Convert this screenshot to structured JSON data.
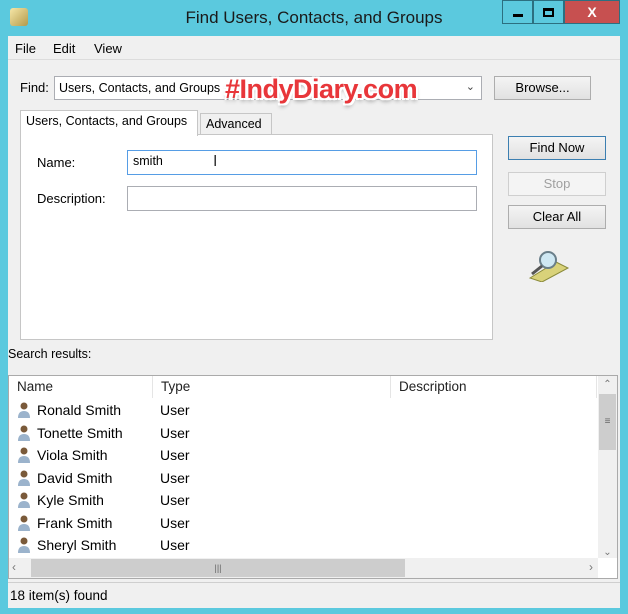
{
  "window": {
    "title": "Find Users, Contacts, and Groups",
    "close": "X"
  },
  "menu": [
    "File",
    "Edit",
    "View"
  ],
  "find": {
    "label": "Find:",
    "value": "Users, Contacts, and Groups",
    "browse": "Browse..."
  },
  "tabs": [
    "Users, Contacts, and Groups",
    "Advanced"
  ],
  "form": {
    "name_label": "Name:",
    "name_value": "smith",
    "description_label": "Description:",
    "description_value": ""
  },
  "actions": {
    "find_now": "Find Now",
    "stop": "Stop",
    "clear_all": "Clear All"
  },
  "results": {
    "label": "Search results:",
    "columns": [
      "Name",
      "Type",
      "Description"
    ],
    "rows": [
      [
        "Ronald Smith",
        "User"
      ],
      [
        "Tonette Smith",
        "User"
      ],
      [
        "Viola Smith",
        "User"
      ],
      [
        "David Smith",
        "User"
      ],
      [
        "Kyle Smith",
        "User"
      ],
      [
        "Frank Smith",
        "User"
      ],
      [
        "Sheryl Smith",
        "User"
      ]
    ]
  },
  "status": "18 item(s) found",
  "watermark": "#IndyDiary.com",
  "colors": {
    "frame": "#5bc9de",
    "close": "#c75050",
    "watermark": "#e8363a"
  }
}
